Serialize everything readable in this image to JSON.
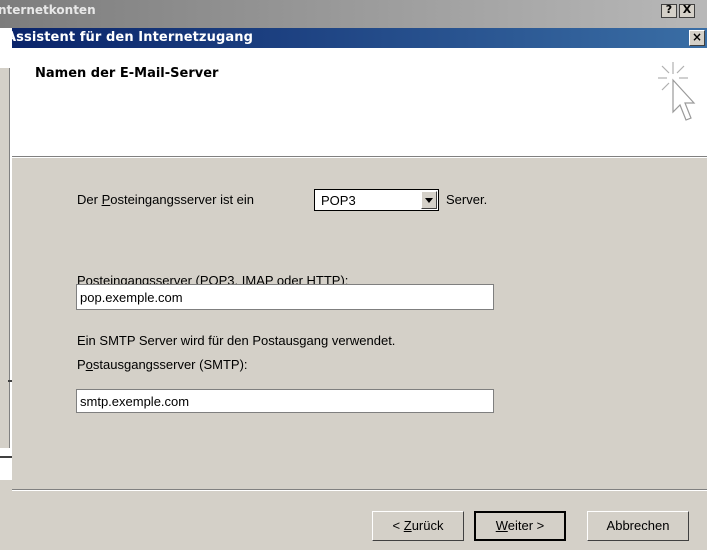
{
  "background_window": {
    "title": "nternetkonten",
    "buttons": [
      "?",
      "X"
    ]
  },
  "dialog": {
    "title": "Assistent für den Internetzugang",
    "close_glyph": "×"
  },
  "header": {
    "title": "Namen der E-Mail-Server"
  },
  "incoming_type": {
    "label_pre": "Der ",
    "label_access": "P",
    "label_post": "osteingangsserver ist ein",
    "selected": "POP3",
    "suffix": "Server."
  },
  "incoming_server": {
    "label_pre": "Posteingangs",
    "label_access": "s",
    "label_post": "erver (POP3, IMAP oder HTTP):",
    "value": "pop.exemple.com"
  },
  "smtp_note": "Ein SMTP Server wird für den Postausgang verwendet.",
  "outgoing_server": {
    "label_pre": "P",
    "label_access": "o",
    "label_post": "stausgangsserver (SMTP):",
    "value": "smtp.exemple.com"
  },
  "buttons": {
    "back": {
      "pre": "< ",
      "access": "Z",
      "post": "urück"
    },
    "next": {
      "pre": "",
      "access": "W",
      "post": "eiter >"
    },
    "cancel": "Abbrechen"
  }
}
